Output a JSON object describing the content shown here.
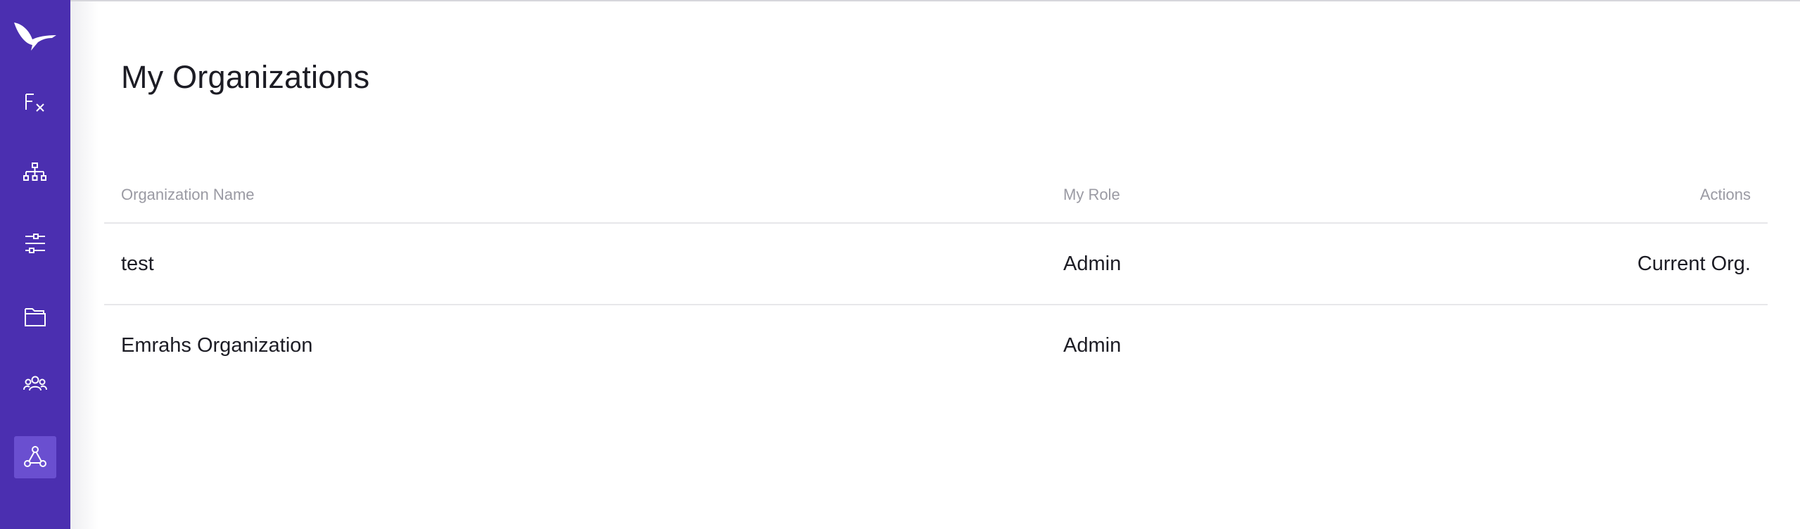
{
  "sidebar": {
    "logo_icon": "bird-logo-icon",
    "items": [
      {
        "icon": "function-icon",
        "active": false
      },
      {
        "icon": "hierarchy-icon",
        "active": false
      },
      {
        "icon": "filters-icon",
        "active": false
      },
      {
        "icon": "folder-icon",
        "active": false
      },
      {
        "icon": "team-icon",
        "active": false
      },
      {
        "icon": "organization-icon",
        "active": true
      }
    ]
  },
  "page": {
    "title": "My Organizations"
  },
  "table": {
    "headers": {
      "name": "Organization Name",
      "role": "My Role",
      "actions": "Actions"
    },
    "rows": [
      {
        "name": "test",
        "role": "Admin",
        "action": "Current Org."
      },
      {
        "name": "Emrahs Organization",
        "role": "Admin",
        "action": ""
      }
    ]
  },
  "colors": {
    "sidebar": "#4b2fb0",
    "sidebar_active": "#6a4fd0",
    "text": "#1c1c24",
    "header_text": "#9a9aa3",
    "divider": "#e7e7ea"
  }
}
